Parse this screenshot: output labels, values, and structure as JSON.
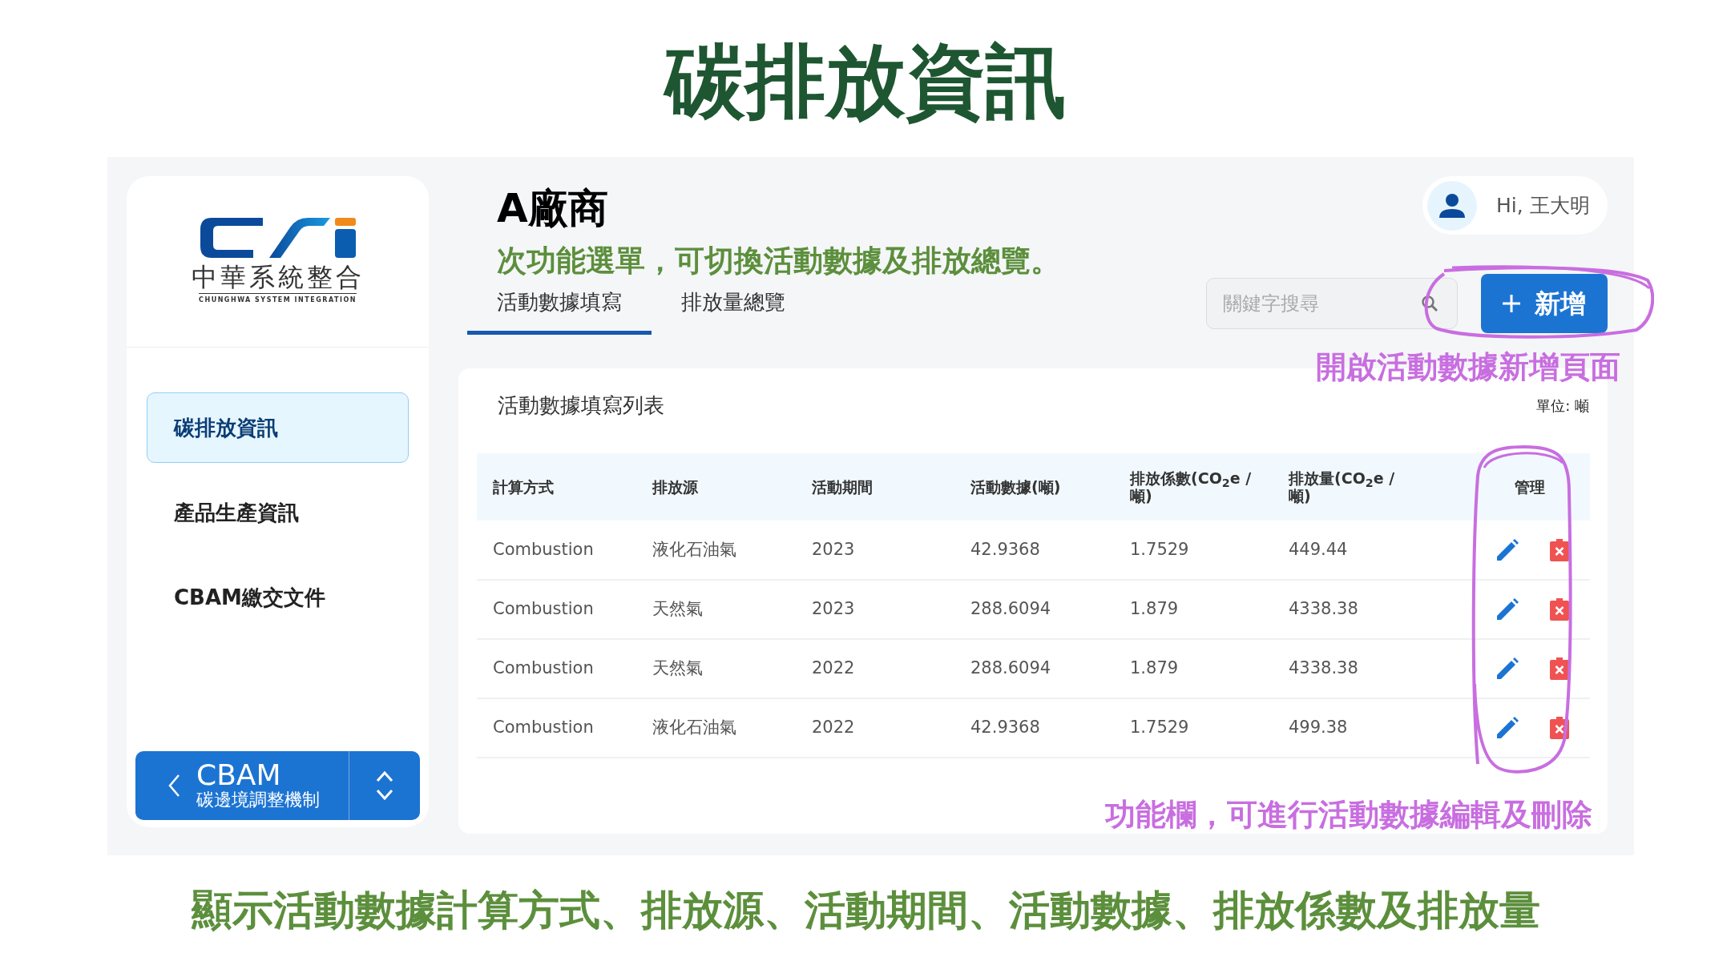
{
  "slide_title": "碳排放資訊",
  "sidebar": {
    "logo": {
      "name": "中華系統整合",
      "tagline": "CHUNGHWA SYSTEM INTEGRATION"
    },
    "items": [
      {
        "label": "碳排放資訊",
        "selected": true
      },
      {
        "label": "產品生產資訊",
        "selected": false
      },
      {
        "label": "CBAM繳交文件",
        "selected": false
      }
    ],
    "system_switcher": {
      "title": "CBAM",
      "subtitle": "碳邊境調整機制"
    }
  },
  "header": {
    "company": "A廠商",
    "user_greeting": "Hi, 王大明"
  },
  "tabs": [
    {
      "label": "活動數據填寫",
      "selected": true
    },
    {
      "label": "排放量總覽",
      "selected": false
    }
  ],
  "search": {
    "placeholder": "關鍵字搜尋"
  },
  "add_button": {
    "label": "新增"
  },
  "list": {
    "title": "活動數據填寫列表",
    "unit": "單位: 噸",
    "columns": [
      "計算方式",
      "排放源",
      "活動期間",
      "活動數據(噸)",
      "排放係數(CO$_{2}$e / 噸)",
      "排放量(CO$_{2}$e / 噸)",
      "管理"
    ],
    "rows": [
      [
        "Combustion",
        "液化石油氣",
        "2023",
        "42.9368",
        "1.7529",
        "449.44"
      ],
      [
        "Combustion",
        "天然氣",
        "2023",
        "288.6094",
        "1.879",
        "4338.38"
      ],
      [
        "Combustion",
        "天然氣",
        "2022",
        "288.6094",
        "1.879",
        "4338.38"
      ],
      [
        "Combustion",
        "液化石油氣",
        "2022",
        "42.9368",
        "1.7529",
        "499.38"
      ]
    ]
  },
  "annotations": {
    "tabs_note": "次功能選單，可切換活動數據及排放總覽。",
    "add_note": "開啟活動數據新增頁面",
    "actions_note": "功能欄，可進行活動數據編輯及刪除"
  },
  "caption": "顯示活動數據計算方式、排放源、活動期間、活動數據、排放係數及排放量"
}
